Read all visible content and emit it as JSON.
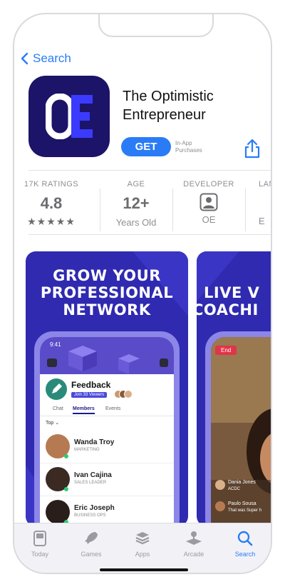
{
  "nav": {
    "back_label": "Search"
  },
  "app": {
    "icon_text": "OE",
    "title": "The Optimistic Entrepreneur",
    "get_label": "GET",
    "iap_label": "In-App Purchases"
  },
  "stats": {
    "ratings": {
      "label": "17K RATINGS",
      "value": "4.8",
      "stars": "★★★★★"
    },
    "age": {
      "label": "AGE",
      "value": "12+",
      "sub": "Years Old"
    },
    "developer": {
      "label": "DEVELOPER",
      "sub": "OE"
    },
    "language": {
      "label": "LAN",
      "sub": "E"
    }
  },
  "screenshots": {
    "s1": {
      "headline1": "GROW YOUR",
      "headline2": "PROFESSIONAL",
      "headline3": "NETWORK",
      "time": "9:41",
      "room_title": "Feedback",
      "join_label": "Join 33 Viewers",
      "tabs": [
        "Chat",
        "Members",
        "Events"
      ],
      "filter": "Top",
      "people": [
        {
          "name": "Wanda Troy",
          "role": "MARKETING"
        },
        {
          "name": "Ivan Cajina",
          "role": "SALES LEADER"
        },
        {
          "name": "Eric Joseph",
          "role": "BUSINESS OPS"
        }
      ]
    },
    "s2": {
      "headline1": "LIVE V",
      "headline2": "COACHI",
      "end_label": "End",
      "c1_name": "Dania Jones",
      "c1_sub": "ACDC",
      "c2_name": "Paulo Sousa",
      "c2_sub": "That was Super h"
    }
  },
  "tabbar": {
    "items": [
      {
        "label": "Today",
        "icon": "today-icon"
      },
      {
        "label": "Games",
        "icon": "games-icon"
      },
      {
        "label": "Apps",
        "icon": "apps-icon"
      },
      {
        "label": "Arcade",
        "icon": "arcade-icon"
      },
      {
        "label": "Search",
        "icon": "search-icon"
      }
    ],
    "active": "Search"
  },
  "colors": {
    "accent": "#2a7cf6",
    "icon_bg": "#1c1468",
    "card_bg": "#2f2ab0"
  }
}
